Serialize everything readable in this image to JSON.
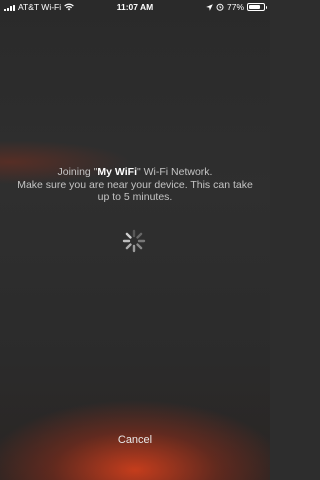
{
  "status_bar": {
    "carrier": "AT&T Wi-Fi",
    "time": "11:07 AM",
    "battery_percent": "77%",
    "battery_level": 0.77,
    "icons": [
      "signal-bars-icon",
      "wifi-icon",
      "location-arrow-icon",
      "alarm-clock-icon",
      "battery-icon"
    ]
  },
  "joining": {
    "prefix": "Joining \"",
    "network_name": "My WiFi",
    "suffix": "\" Wi-Fi Network.",
    "instruction": "Make sure you are near your device. This can take up to 5 minutes."
  },
  "spinner": {
    "icon": "loading-spinner-icon"
  },
  "actions": {
    "cancel_label": "Cancel"
  },
  "colors": {
    "background": "#2d2d2d",
    "accent_glow": "#cd3e1c",
    "text": "#c4c4c4"
  }
}
